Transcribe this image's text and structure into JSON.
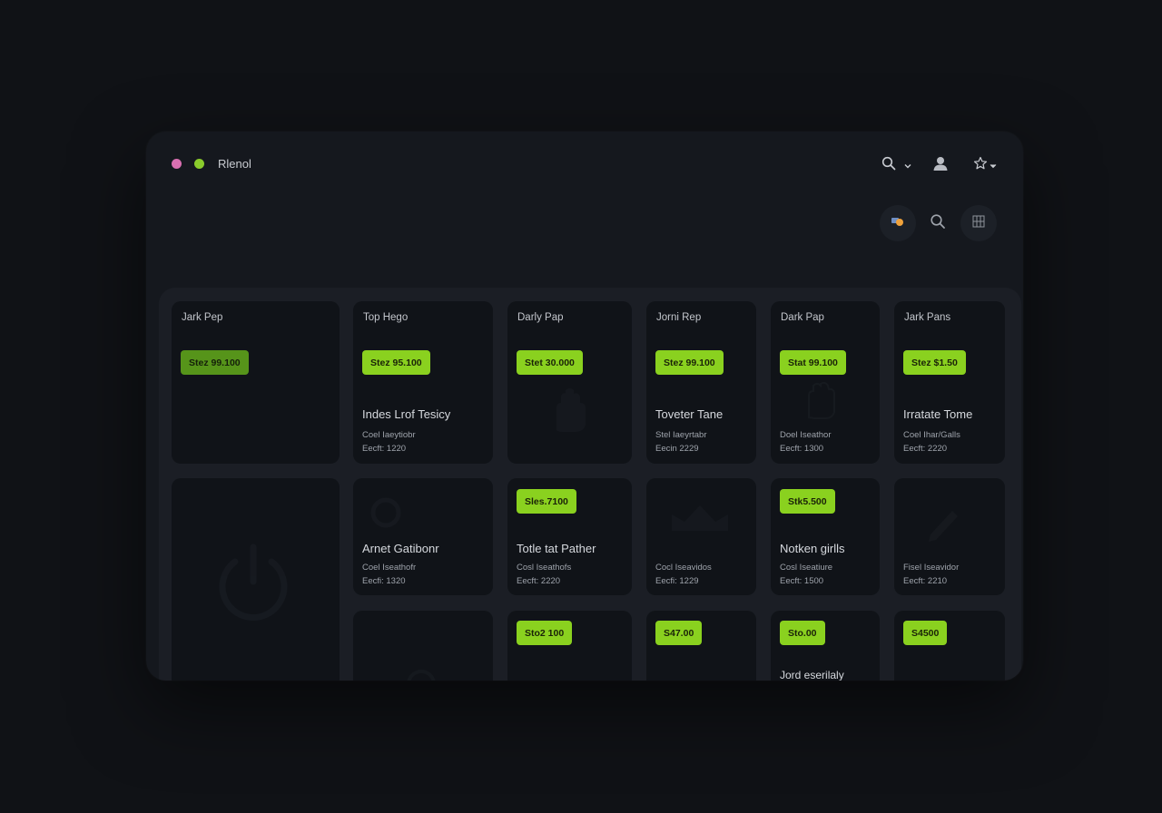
{
  "window": {
    "title": "Rlenol"
  },
  "colors": {
    "accent": "#8ad11f",
    "accent_dim": "#56941a",
    "dot_pink": "#d96fb1",
    "dot_green": "#8acb2c",
    "background": "#101216",
    "card": "#101318"
  },
  "toolbar": {
    "icons": [
      "search-icon",
      "chevron-down-icon",
      "user-icon",
      "star-icon",
      "chevron-down-icon"
    ]
  },
  "actions": {
    "icons": [
      "badge-icon",
      "search-icon",
      "grid-icon"
    ]
  },
  "cards": [
    {
      "title": "Jark Pep",
      "price": "Stez 99.100",
      "name": "",
      "meta1": "",
      "meta2": ""
    },
    {
      "title": "Top Hego",
      "price": "Stez 95.100",
      "name": "Indes Lrof Tesicy",
      "meta1": "Coel Iaeytiobr",
      "meta2": "Eecft: 1220"
    },
    {
      "title": "Darly Pap",
      "price": "Stet 30.000",
      "name": "",
      "meta1": "",
      "meta2": ""
    },
    {
      "title": "Jorni Rep",
      "price": "Stez 99.100",
      "name": "Toveter Tane",
      "meta1": "Stel Iaeyrtabr",
      "meta2": "Eecin 2229"
    },
    {
      "title": "Dark Pap",
      "price": "Stat 99.100",
      "name": "",
      "meta1": "Doel Iseathor",
      "meta2": "Eecft: 1300"
    },
    {
      "title": "Jark Pans",
      "price": "Stez $1.50",
      "name": "Irratate Tome",
      "meta1": "Coel Ihar/Galls",
      "meta2": "Eecft: 2220"
    },
    {
      "title": "",
      "price": "",
      "name": "",
      "meta1": "",
      "meta2": ""
    },
    {
      "title": "",
      "price": "",
      "name": "Arnet Gatibonr",
      "meta1": "Coel Iseathofr",
      "meta2": "Eecfi: 1320"
    },
    {
      "title": "",
      "price": "Sles.7100",
      "name": "Totle tat Pather",
      "meta1": "Cosl Iseathofs",
      "meta2": "Eecft: 2220"
    },
    {
      "title": "",
      "price": "",
      "name": "",
      "meta1": "Cocl Iseavidos",
      "meta2": "Eecfi: 1229"
    },
    {
      "title": "",
      "price": "Stk5.500",
      "name": "Notken girlls",
      "meta1": "Cosl Iseatiure",
      "meta2": "Eecft: 1500"
    },
    {
      "title": "",
      "price": "",
      "name": "",
      "meta1": "Fisel Iseavidor",
      "meta2": "Eecft: 2210"
    },
    {
      "title": "",
      "price": "",
      "name": "",
      "meta1": "",
      "meta2": ""
    },
    {
      "title": "",
      "price": "Sto2 100",
      "name": "",
      "meta1": "",
      "meta2": ""
    },
    {
      "title": "",
      "price": "S47.00",
      "name": "",
      "meta1": "",
      "meta2": ""
    },
    {
      "title": "",
      "price": "Sto.00",
      "name": "Jord eserilaly",
      "meta1": "",
      "meta2": ""
    },
    {
      "title": "",
      "price": "S4500",
      "name": "",
      "meta1": "",
      "meta2": ""
    }
  ]
}
